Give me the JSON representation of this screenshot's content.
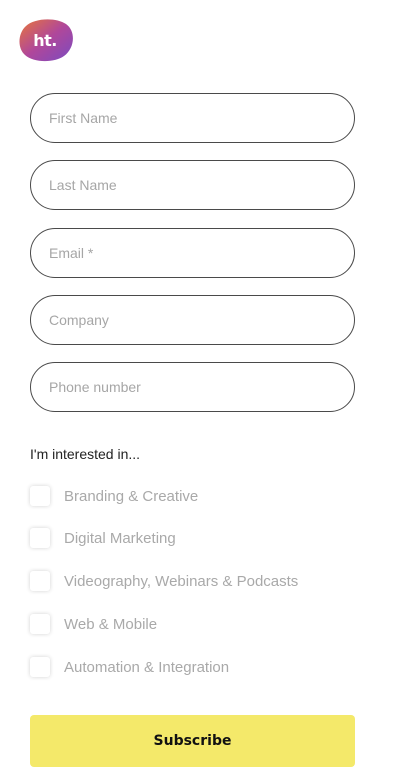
{
  "brand": {
    "logo_text": "ht.",
    "gradient_start": "#e8763a",
    "gradient_mid": "#b0479a",
    "gradient_end": "#7a4bc0"
  },
  "form": {
    "first_name": {
      "placeholder": "First Name",
      "value": ""
    },
    "last_name": {
      "placeholder": "Last Name",
      "value": ""
    },
    "email": {
      "placeholder": "Email *",
      "value": ""
    },
    "company": {
      "placeholder": "Company",
      "value": ""
    },
    "phone": {
      "placeholder": "Phone number",
      "value": ""
    }
  },
  "interests": {
    "heading": "I'm interested in...",
    "options": [
      {
        "label": "Branding & Creative",
        "checked": false
      },
      {
        "label": "Digital Marketing",
        "checked": false
      },
      {
        "label": "Videography, Webinars & Podcasts",
        "checked": false
      },
      {
        "label": "Web & Mobile",
        "checked": false
      },
      {
        "label": "Automation & Integration",
        "checked": false
      }
    ]
  },
  "subscribe": {
    "label": "Subscribe",
    "color": "#f4e96a"
  }
}
